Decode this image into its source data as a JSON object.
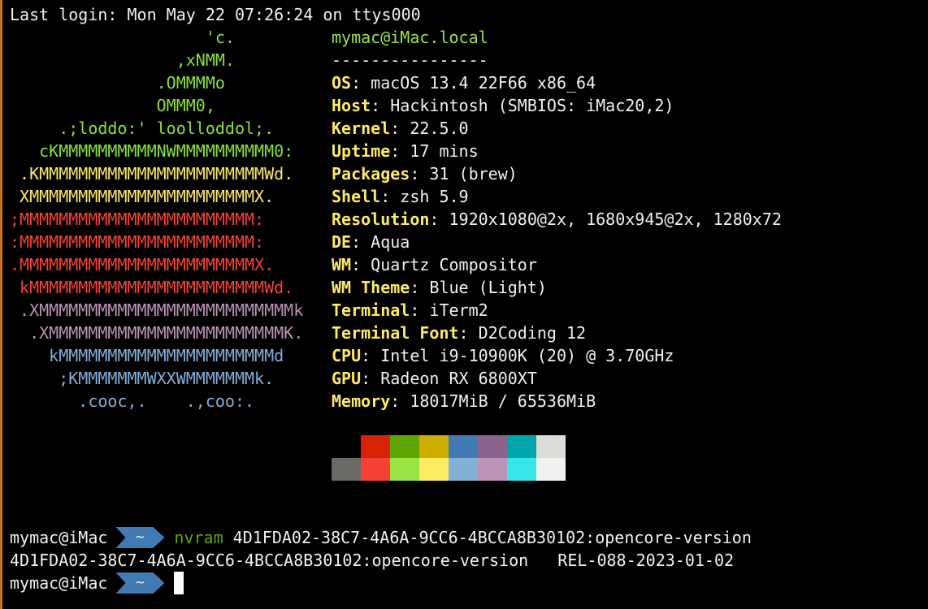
{
  "last_login": "Last login: Mon May 22 07:26:24 on ttys000",
  "logo": {
    "lines": [
      {
        "text": "                    'c.",
        "color": "#8ae234"
      },
      {
        "text": "                 ,xNMM.",
        "color": "#8ae234"
      },
      {
        "text": "               .OMMMMo",
        "color": "#8ae234"
      },
      {
        "text": "               OMMM0,",
        "color": "#8ae234"
      },
      {
        "text": "     .;loddo:' loolloddol;.",
        "color": "#8ae234"
      },
      {
        "text": "   cKMMMMMMMMMMNWMMMMMMMMMM0:",
        "color": "#8ae234"
      },
      {
        "text": " .KMMMMMMMMMMMMMMMMMMMMMMMWd.",
        "color": "#fdeb61"
      },
      {
        "text": " XMMMMMMMMMMMMMMMMMMMMMMMX.",
        "color": "#fdeb61"
      },
      {
        "text": ";MMMMMMMMMMMMMMMMMMMMMMMM:",
        "color": "#f54235"
      },
      {
        "text": ":MMMMMMMMMMMMMMMMMMMMMMMM:",
        "color": "#f54235"
      },
      {
        "text": ".MMMMMMMMMMMMMMMMMMMMMMMMX.",
        "color": "#f54235"
      },
      {
        "text": " kMMMMMMMMMMMMMMMMMMMMMMMMWd.",
        "color": "#f54235"
      },
      {
        "text": " .XMMMMMMMMMMMMMMMMMMMMMMMMMMk",
        "color": "#bc94b7"
      },
      {
        "text": "  .XMMMMMMMMMMMMMMMMMMMMMMMMK.",
        "color": "#bc94b7"
      },
      {
        "text": "    kMMMMMMMMMMMMMMMMMMMMMMd",
        "color": "#84b0d8"
      },
      {
        "text": "     ;KMMMMMMMWXXWMMMMMMMk.",
        "color": "#84b0d8"
      },
      {
        "text": "       .cooc,.    .,coo:.",
        "color": "#84b0d8"
      }
    ]
  },
  "info": {
    "title": "mymac@iMac.local",
    "separator": "----------------",
    "fields": [
      {
        "label": "OS",
        "value": ": macOS 13.4 22F66 x86_64"
      },
      {
        "label": "Host",
        "value": ": Hackintosh (SMBIOS: iMac20,2)"
      },
      {
        "label": "Kernel",
        "value": ": 22.5.0"
      },
      {
        "label": "Uptime",
        "value": ": 17 mins"
      },
      {
        "label": "Packages",
        "value": ": 31 (brew)"
      },
      {
        "label": "Shell",
        "value": ": zsh 5.9"
      },
      {
        "label": "Resolution",
        "value": ": 1920x1080@2x, 1680x945@2x, 1280x72"
      },
      {
        "label": "DE",
        "value": ": Aqua"
      },
      {
        "label": "WM",
        "value": ": Quartz Compositor"
      },
      {
        "label": "WM Theme",
        "value": ": Blue (Light)"
      },
      {
        "label": "Terminal",
        "value": ": iTerm2"
      },
      {
        "label": "Terminal Font",
        "value": ": D2Coding 12"
      },
      {
        "label": "CPU",
        "value": ": Intel i9-10900K (20) @ 3.70GHz"
      },
      {
        "label": "GPU",
        "value": ": Radeon RX 6800XT"
      },
      {
        "label": "Memory",
        "value": ": 18017MiB / 65536MiB"
      }
    ]
  },
  "palette": {
    "normal": [
      "#000000",
      "#d92103",
      "#5ea702",
      "#cfae00",
      "#427ab3",
      "#89658e",
      "#00a7aa",
      "#dbded8"
    ],
    "bright": [
      "#686a66",
      "#f54235",
      "#99e343",
      "#fdeb61",
      "#84b0d8",
      "#bc94b7",
      "#37e6e8",
      "#f1f1f0"
    ]
  },
  "prompt": {
    "user": "mymac@iMac",
    "dir": "~",
    "command": "nvram",
    "args": " 4D1FDA02-38C7-4A6A-9CC6-4BCCA8B30102:opencore-version"
  },
  "output": "4D1FDA02-38C7-4A6A-9CC6-4BCCA8B30102:opencore-version   REL-088-2023-01-02",
  "prompt2": {
    "user": "mymac@iMac",
    "dir": "~"
  }
}
